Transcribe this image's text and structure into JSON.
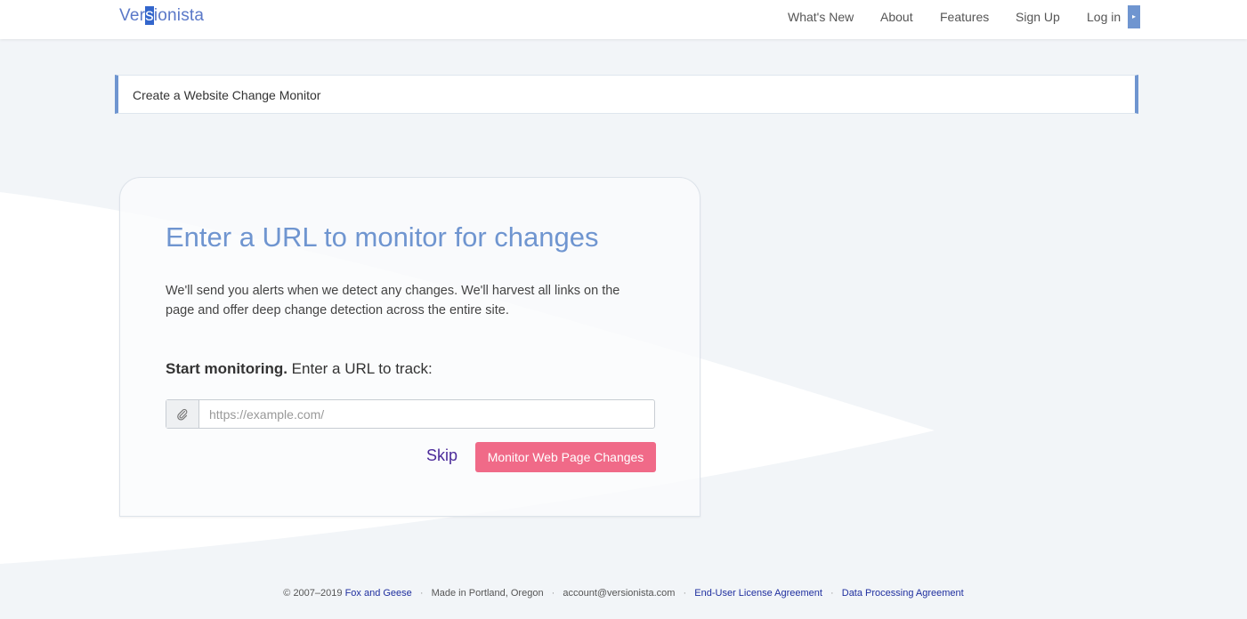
{
  "logo": {
    "text_before": "Ver",
    "text_selected": "s",
    "text_after": "ionista"
  },
  "nav": {
    "items": [
      "What's New",
      "About",
      "Features",
      "Sign Up",
      "Log in"
    ]
  },
  "breadcrumb": {
    "label": "Create a Website Change Monitor"
  },
  "card": {
    "heading": "Enter a URL to monitor for changes",
    "description": "We'll send you alerts when we detect any changes. We'll harvest all links on the page and offer deep change detection across the entire site.",
    "start_bold": "Start monitoring.",
    "start_rest": " Enter a URL to track:",
    "url_placeholder": "https://example.com/",
    "url_value": "",
    "skip_label": "Skip",
    "submit_label": "Monitor Web Page Changes"
  },
  "footer": {
    "copyright": "© 2007–2019",
    "company_link": "Fox and Geese",
    "made_in": "Made in Portland, Oregon",
    "email": "account@versionista.com",
    "eula_link": "End-User License Agreement",
    "dpa_link": "Data Processing Agreement"
  },
  "colors": {
    "accent": "#6f95d0",
    "button": "#f06a88",
    "link": "#1f2f9f",
    "skip": "#4b2a9a"
  }
}
